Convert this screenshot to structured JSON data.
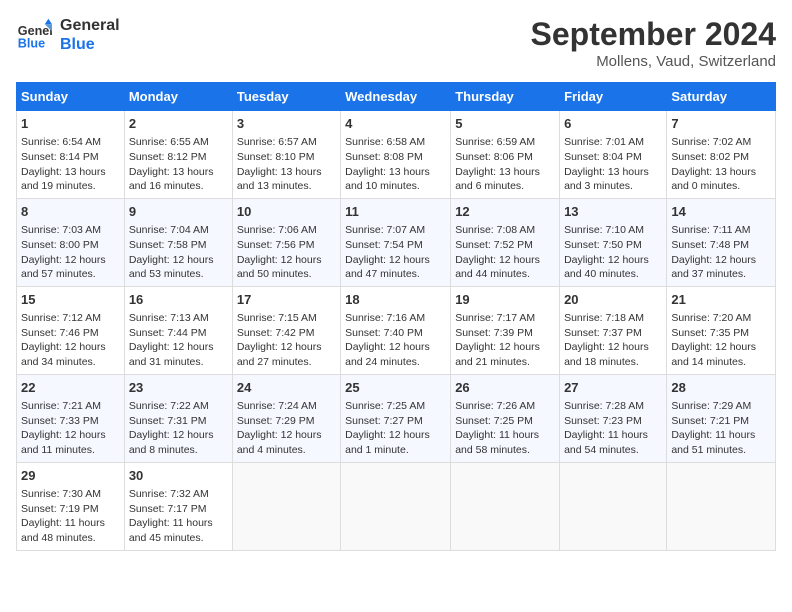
{
  "header": {
    "logo_line1": "General",
    "logo_line2": "Blue",
    "month": "September 2024",
    "location": "Mollens, Vaud, Switzerland"
  },
  "columns": [
    "Sunday",
    "Monday",
    "Tuesday",
    "Wednesday",
    "Thursday",
    "Friday",
    "Saturday"
  ],
  "weeks": [
    [
      {
        "day": "1",
        "info": "Sunrise: 6:54 AM\nSunset: 8:14 PM\nDaylight: 13 hours\nand 19 minutes."
      },
      {
        "day": "2",
        "info": "Sunrise: 6:55 AM\nSunset: 8:12 PM\nDaylight: 13 hours\nand 16 minutes."
      },
      {
        "day": "3",
        "info": "Sunrise: 6:57 AM\nSunset: 8:10 PM\nDaylight: 13 hours\nand 13 minutes."
      },
      {
        "day": "4",
        "info": "Sunrise: 6:58 AM\nSunset: 8:08 PM\nDaylight: 13 hours\nand 10 minutes."
      },
      {
        "day": "5",
        "info": "Sunrise: 6:59 AM\nSunset: 8:06 PM\nDaylight: 13 hours\nand 6 minutes."
      },
      {
        "day": "6",
        "info": "Sunrise: 7:01 AM\nSunset: 8:04 PM\nDaylight: 13 hours\nand 3 minutes."
      },
      {
        "day": "7",
        "info": "Sunrise: 7:02 AM\nSunset: 8:02 PM\nDaylight: 13 hours\nand 0 minutes."
      }
    ],
    [
      {
        "day": "8",
        "info": "Sunrise: 7:03 AM\nSunset: 8:00 PM\nDaylight: 12 hours\nand 57 minutes."
      },
      {
        "day": "9",
        "info": "Sunrise: 7:04 AM\nSunset: 7:58 PM\nDaylight: 12 hours\nand 53 minutes."
      },
      {
        "day": "10",
        "info": "Sunrise: 7:06 AM\nSunset: 7:56 PM\nDaylight: 12 hours\nand 50 minutes."
      },
      {
        "day": "11",
        "info": "Sunrise: 7:07 AM\nSunset: 7:54 PM\nDaylight: 12 hours\nand 47 minutes."
      },
      {
        "day": "12",
        "info": "Sunrise: 7:08 AM\nSunset: 7:52 PM\nDaylight: 12 hours\nand 44 minutes."
      },
      {
        "day": "13",
        "info": "Sunrise: 7:10 AM\nSunset: 7:50 PM\nDaylight: 12 hours\nand 40 minutes."
      },
      {
        "day": "14",
        "info": "Sunrise: 7:11 AM\nSunset: 7:48 PM\nDaylight: 12 hours\nand 37 minutes."
      }
    ],
    [
      {
        "day": "15",
        "info": "Sunrise: 7:12 AM\nSunset: 7:46 PM\nDaylight: 12 hours\nand 34 minutes."
      },
      {
        "day": "16",
        "info": "Sunrise: 7:13 AM\nSunset: 7:44 PM\nDaylight: 12 hours\nand 31 minutes."
      },
      {
        "day": "17",
        "info": "Sunrise: 7:15 AM\nSunset: 7:42 PM\nDaylight: 12 hours\nand 27 minutes."
      },
      {
        "day": "18",
        "info": "Sunrise: 7:16 AM\nSunset: 7:40 PM\nDaylight: 12 hours\nand 24 minutes."
      },
      {
        "day": "19",
        "info": "Sunrise: 7:17 AM\nSunset: 7:39 PM\nDaylight: 12 hours\nand 21 minutes."
      },
      {
        "day": "20",
        "info": "Sunrise: 7:18 AM\nSunset: 7:37 PM\nDaylight: 12 hours\nand 18 minutes."
      },
      {
        "day": "21",
        "info": "Sunrise: 7:20 AM\nSunset: 7:35 PM\nDaylight: 12 hours\nand 14 minutes."
      }
    ],
    [
      {
        "day": "22",
        "info": "Sunrise: 7:21 AM\nSunset: 7:33 PM\nDaylight: 12 hours\nand 11 minutes."
      },
      {
        "day": "23",
        "info": "Sunrise: 7:22 AM\nSunset: 7:31 PM\nDaylight: 12 hours\nand 8 minutes."
      },
      {
        "day": "24",
        "info": "Sunrise: 7:24 AM\nSunset: 7:29 PM\nDaylight: 12 hours\nand 4 minutes."
      },
      {
        "day": "25",
        "info": "Sunrise: 7:25 AM\nSunset: 7:27 PM\nDaylight: 12 hours\nand 1 minute."
      },
      {
        "day": "26",
        "info": "Sunrise: 7:26 AM\nSunset: 7:25 PM\nDaylight: 11 hours\nand 58 minutes."
      },
      {
        "day": "27",
        "info": "Sunrise: 7:28 AM\nSunset: 7:23 PM\nDaylight: 11 hours\nand 54 minutes."
      },
      {
        "day": "28",
        "info": "Sunrise: 7:29 AM\nSunset: 7:21 PM\nDaylight: 11 hours\nand 51 minutes."
      }
    ],
    [
      {
        "day": "29",
        "info": "Sunrise: 7:30 AM\nSunset: 7:19 PM\nDaylight: 11 hours\nand 48 minutes."
      },
      {
        "day": "30",
        "info": "Sunrise: 7:32 AM\nSunset: 7:17 PM\nDaylight: 11 hours\nand 45 minutes."
      },
      {
        "day": "",
        "info": ""
      },
      {
        "day": "",
        "info": ""
      },
      {
        "day": "",
        "info": ""
      },
      {
        "day": "",
        "info": ""
      },
      {
        "day": "",
        "info": ""
      }
    ]
  ]
}
